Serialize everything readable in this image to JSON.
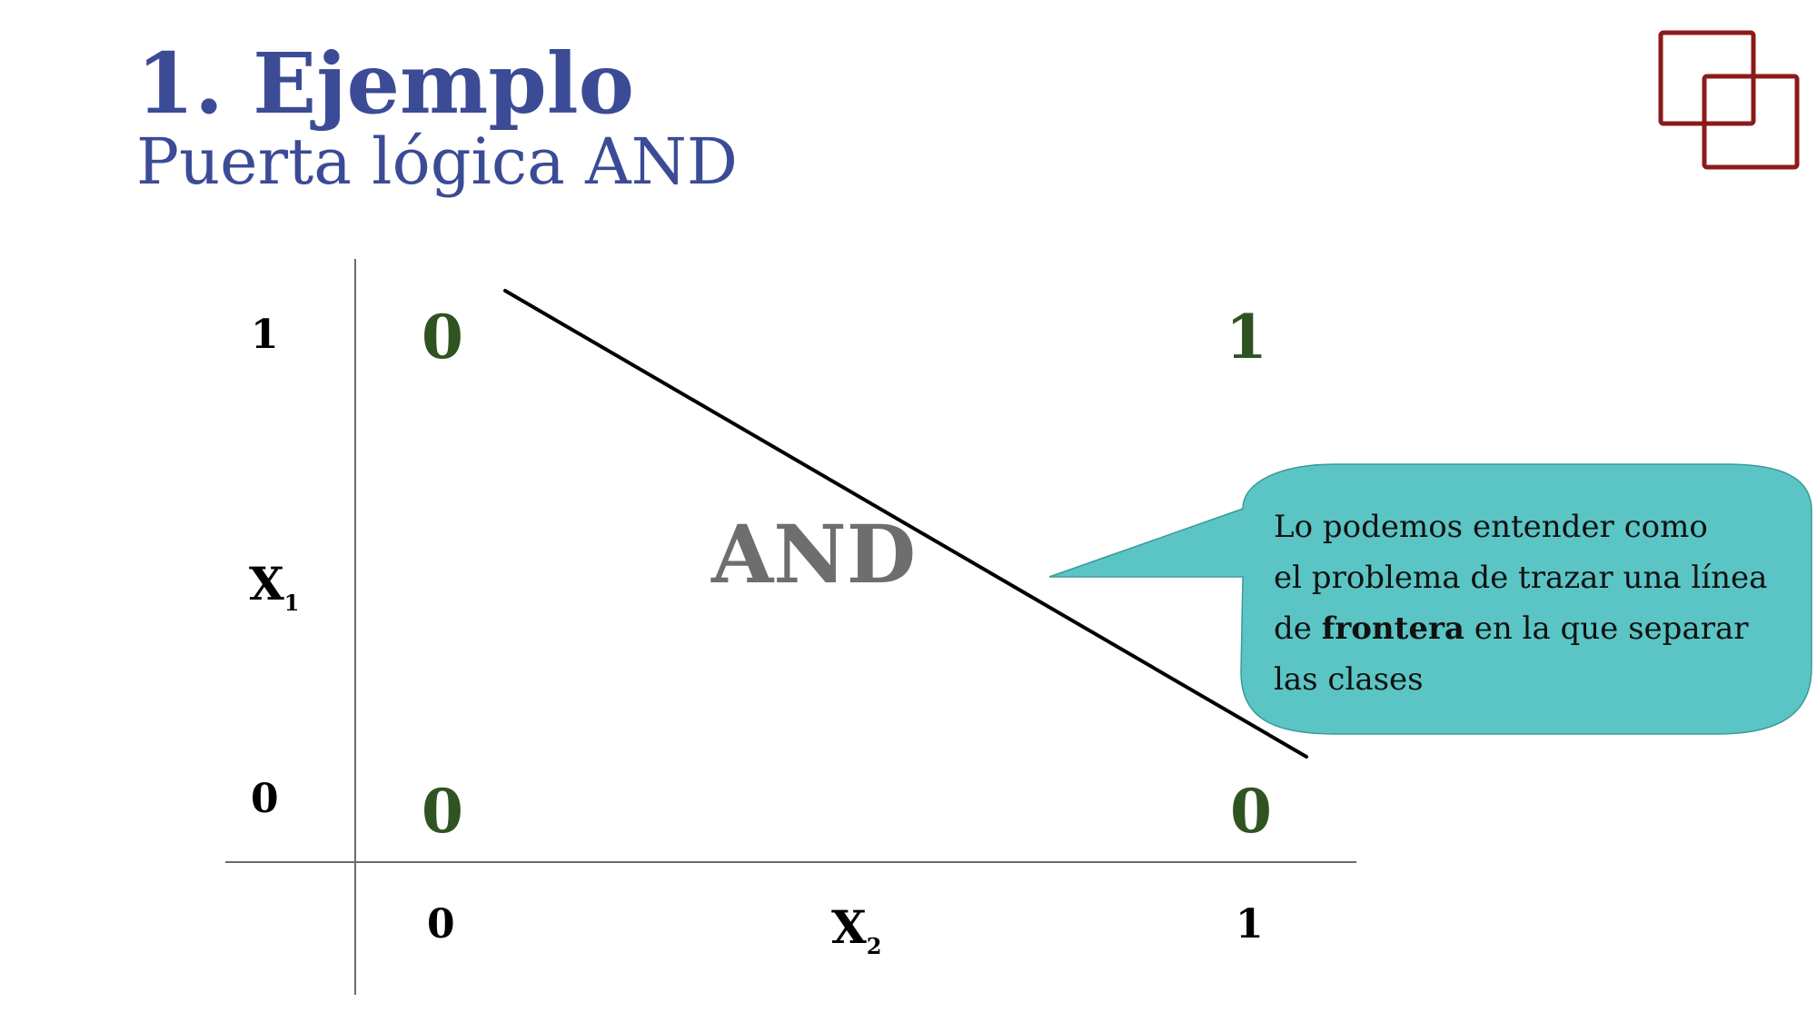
{
  "header": {
    "title": "1. Ejemplo",
    "subtitle": "Puerta lógica AND"
  },
  "diagram": {
    "y_axis": {
      "name": "X",
      "name_sub": "1",
      "ticks": [
        "1",
        "0"
      ]
    },
    "x_axis": {
      "name": "X",
      "name_sub": "2",
      "ticks": [
        "0",
        "1"
      ]
    },
    "points": [
      {
        "x1": 1,
        "x2": 0,
        "output": "0"
      },
      {
        "x1": 1,
        "x2": 1,
        "output": "1"
      },
      {
        "x1": 0,
        "x2": 0,
        "output": "0"
      },
      {
        "x1": 0,
        "x2": 1,
        "output": "0"
      }
    ],
    "gate_label": "AND"
  },
  "callout": {
    "line1": "Lo podemos entender como",
    "line2": "el problema de trazar una línea",
    "line3_pre": "de ",
    "line3_bold": "frontera",
    "line3_post": " en la que separar",
    "line4": "las clases"
  },
  "colors": {
    "title": "#3b4b96",
    "values": "#2f5321",
    "gate_label": "#6e6e6e",
    "callout_fill": "#5bc4c4",
    "logo": "#8b1a1a"
  }
}
